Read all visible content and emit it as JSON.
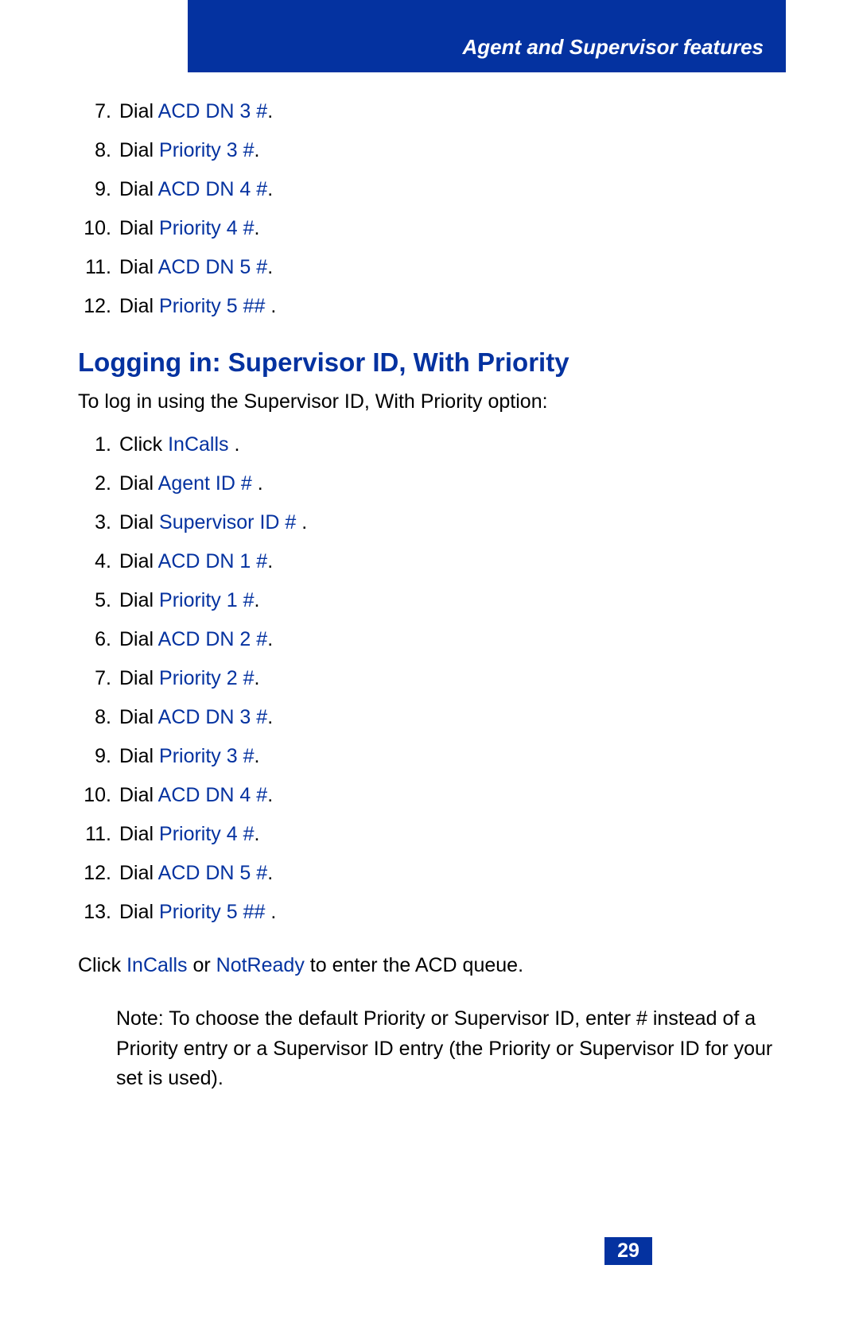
{
  "header": {
    "title": "Agent and Supervisor features"
  },
  "list1": [
    {
      "n": "7.",
      "prefix": "Dial ",
      "link": "ACD DN 3 #",
      "suffix": "."
    },
    {
      "n": "8.",
      "prefix": "Dial ",
      "link": "Priority 3 #",
      "suffix": "."
    },
    {
      "n": "9.",
      "prefix": "Dial ",
      "link": "ACD DN 4 #",
      "suffix": "."
    },
    {
      "n": "10.",
      "prefix": "Dial ",
      "link": "Priority 4 #",
      "suffix": "."
    },
    {
      "n": "11.",
      "prefix": "Dial ",
      "link": "ACD DN 5 #",
      "suffix": "."
    },
    {
      "n": "12.",
      "prefix": "Dial ",
      "link": "Priority 5 ##",
      "suffix": " ."
    }
  ],
  "section": {
    "heading": "Logging in: Supervisor ID, With Priority",
    "intro": "To log in using the Supervisor ID, With Priority option:"
  },
  "list2": [
    {
      "n": "1.",
      "prefix": "Click ",
      "link": "InCalls",
      "suffix": " ."
    },
    {
      "n": "2.",
      "prefix": "Dial ",
      "link": "Agent ID #",
      "suffix": " ."
    },
    {
      "n": "3.",
      "prefix": "Dial ",
      "link": "Supervisor ID #",
      "suffix": " ."
    },
    {
      "n": "4.",
      "prefix": "Dial ",
      "link": "ACD DN 1 #",
      "suffix": "."
    },
    {
      "n": "5.",
      "prefix": "Dial ",
      "link": "Priority 1 #",
      "suffix": "."
    },
    {
      "n": "6.",
      "prefix": "Dial ",
      "link": "ACD DN 2 #",
      "suffix": "."
    },
    {
      "n": "7.",
      "prefix": "Dial ",
      "link": "Priority 2 #",
      "suffix": "."
    },
    {
      "n": "8.",
      "prefix": "Dial ",
      "link": "ACD DN 3 #",
      "suffix": "."
    },
    {
      "n": "9.",
      "prefix": "Dial ",
      "link": "Priority 3 #",
      "suffix": "."
    },
    {
      "n": "10.",
      "prefix": "Dial ",
      "link": "ACD DN 4 #",
      "suffix": "."
    },
    {
      "n": "11.",
      "prefix": "Dial ",
      "link": "Priority 4 #",
      "suffix": "."
    },
    {
      "n": "12.",
      "prefix": "Dial ",
      "link": "ACD DN 5 #",
      "suffix": "."
    },
    {
      "n": "13.",
      "prefix": "Dial ",
      "link": "Priority 5 ##",
      "suffix": " ."
    }
  ],
  "sentence": {
    "pre": "Click ",
    "link1": "InCalls",
    "mid": " or ",
    "link2": "NotReady",
    "post": " to enter the ACD queue."
  },
  "note": "Note: To choose the default Priority or Supervisor ID, enter # instead of a Priority entry or a Supervisor ID entry (the Priority or Supervisor ID for your set is used).",
  "page_number": "29"
}
